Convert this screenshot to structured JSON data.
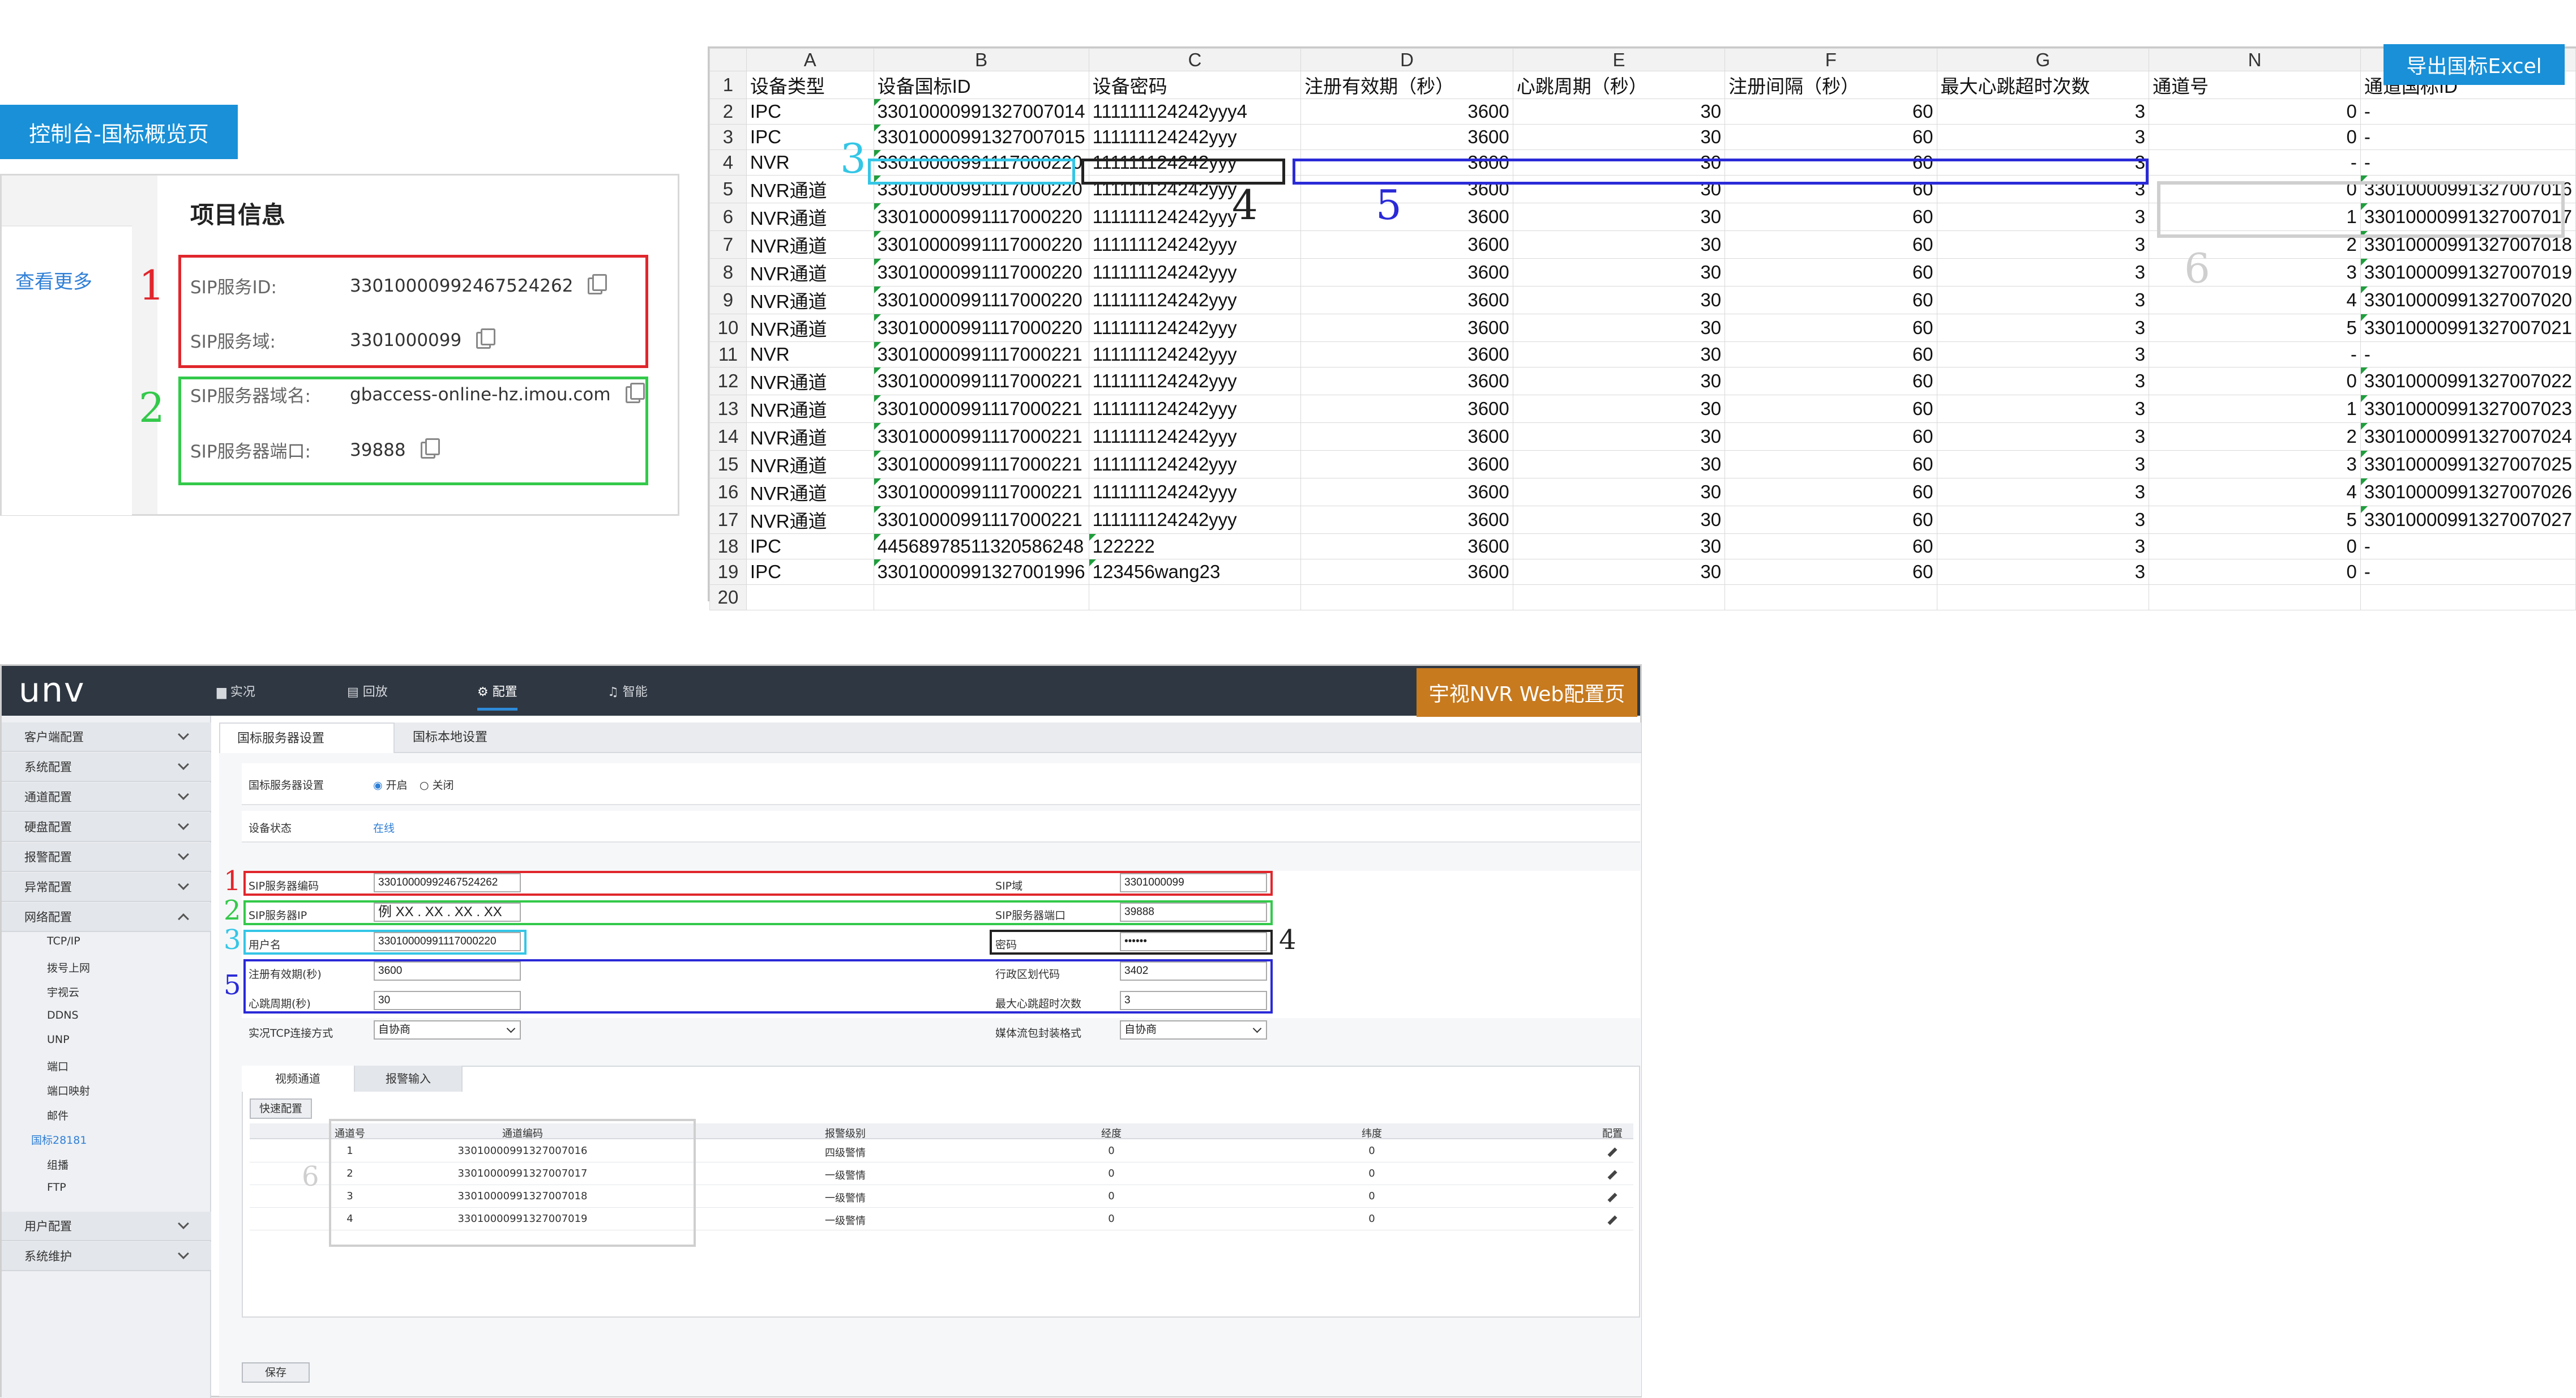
{
  "overview": {
    "tag": "控制台-国标概览页",
    "more_link": "查看更多",
    "title": "项目信息",
    "items": [
      {
        "label": "SIP服务ID:",
        "value": "33010000992467524262"
      },
      {
        "label": "SIP服务域:",
        "value": "3301000099"
      },
      {
        "label": "SIP服务器域名:",
        "value": "gbaccess-online-hz.imou.com"
      },
      {
        "label": "SIP服务器端口:",
        "value": "39888"
      }
    ]
  },
  "markers": {
    "n1": "1",
    "n2": "2",
    "n3": "3",
    "n4": "4",
    "n5": "5",
    "n6": "6"
  },
  "colors": {
    "red": "#e0262c",
    "green": "#33c94a",
    "cyan": "#34c6e6",
    "black": "#222222",
    "blue": "#2a2ad8",
    "gray": "#cfcfcf",
    "tag_blue": "#1990d7",
    "tag_brown": "#c77a1e"
  },
  "excel": {
    "export_button": "导出国标Excel",
    "column_letters": [
      "",
      "A",
      "B",
      "C",
      "D",
      "E",
      "F",
      "G",
      "N",
      ""
    ],
    "header_row": [
      "1",
      "设备类型",
      "设备国标ID",
      "设备密码",
      "注册有效期（秒）",
      "心跳周期（秒）",
      "注册间隔（秒）",
      "最大心跳超时次数",
      "通道号",
      "通道国标ID"
    ],
    "rows": [
      [
        "2",
        "IPC",
        "33010000991327007014",
        "111111124242yyy4",
        "3600",
        "30",
        "60",
        "3",
        "0",
        "-"
      ],
      [
        "3",
        "IPC",
        "33010000991327007015",
        "111111124242yyy",
        "3600",
        "30",
        "60",
        "3",
        "0",
        "-"
      ],
      [
        "4",
        "NVR",
        "33010000991117000220",
        "111111124242yyy",
        "3600",
        "30",
        "60",
        "3",
        "-",
        "-"
      ],
      [
        "5",
        "NVR通道",
        "33010000991117000220",
        "111111124242yyy",
        "3600",
        "30",
        "60",
        "3",
        "0",
        "33010000991327007016"
      ],
      [
        "6",
        "NVR通道",
        "33010000991117000220",
        "111111124242yyy",
        "3600",
        "30",
        "60",
        "3",
        "1",
        "33010000991327007017"
      ],
      [
        "7",
        "NVR通道",
        "33010000991117000220",
        "111111124242yyy",
        "3600",
        "30",
        "60",
        "3",
        "2",
        "33010000991327007018"
      ],
      [
        "8",
        "NVR通道",
        "33010000991117000220",
        "111111124242yyy",
        "3600",
        "30",
        "60",
        "3",
        "3",
        "33010000991327007019"
      ],
      [
        "9",
        "NVR通道",
        "33010000991117000220",
        "111111124242yyy",
        "3600",
        "30",
        "60",
        "3",
        "4",
        "33010000991327007020"
      ],
      [
        "10",
        "NVR通道",
        "33010000991117000220",
        "111111124242yyy",
        "3600",
        "30",
        "60",
        "3",
        "5",
        "33010000991327007021"
      ],
      [
        "11",
        "NVR",
        "33010000991117000221",
        "111111124242yyy",
        "3600",
        "30",
        "60",
        "3",
        "-",
        "-"
      ],
      [
        "12",
        "NVR通道",
        "33010000991117000221",
        "111111124242yyy",
        "3600",
        "30",
        "60",
        "3",
        "0",
        "33010000991327007022"
      ],
      [
        "13",
        "NVR通道",
        "33010000991117000221",
        "111111124242yyy",
        "3600",
        "30",
        "60",
        "3",
        "1",
        "33010000991327007023"
      ],
      [
        "14",
        "NVR通道",
        "33010000991117000221",
        "111111124242yyy",
        "3600",
        "30",
        "60",
        "3",
        "2",
        "33010000991327007024"
      ],
      [
        "15",
        "NVR通道",
        "33010000991117000221",
        "111111124242yyy",
        "3600",
        "30",
        "60",
        "3",
        "3",
        "33010000991327007025"
      ],
      [
        "16",
        "NVR通道",
        "33010000991117000221",
        "111111124242yyy",
        "3600",
        "30",
        "60",
        "3",
        "4",
        "33010000991327007026"
      ],
      [
        "17",
        "NVR通道",
        "33010000991117000221",
        "111111124242yyy",
        "3600",
        "30",
        "60",
        "3",
        "5",
        "33010000991327007027"
      ],
      [
        "18",
        "IPC",
        "44568978511320586248",
        "122222",
        "3600",
        "30",
        "60",
        "3",
        "0",
        "-"
      ],
      [
        "19",
        "IPC",
        "33010000991327001996",
        "123456wang23",
        "3600",
        "30",
        "60",
        "3",
        "0",
        "-"
      ],
      [
        "20",
        "",
        "",
        "",
        "",
        "",
        "",
        "",
        "",
        ""
      ]
    ]
  },
  "nvr": {
    "logo": "unv",
    "tag": "宇视NVR Web配置页",
    "nav": [
      "实况",
      "回放",
      "配置",
      "智能"
    ],
    "menu": [
      "客户端配置",
      "系统配置",
      "通道配置",
      "硬盘配置",
      "报警配置",
      "异常配置",
      "网络配置"
    ],
    "submenu": [
      "TCP/IP",
      "拨号上网",
      "宇视云",
      "DDNS",
      "UNP",
      "端口",
      "端口映射",
      "邮件",
      "国标28181",
      "组播",
      "FTP"
    ],
    "menu_bottom": [
      "用户配置",
      "系统维护"
    ],
    "tabs": [
      "国标服务器设置",
      "国标本地设置"
    ],
    "server_setting_label": "国标服务器设置",
    "radio_on": "开启",
    "radio_off": "关闭",
    "status_label": "设备状态",
    "status_value": "在线",
    "fields": {
      "sip_code_label": "SIP服务器编码",
      "sip_code": "33010000992467524262",
      "sip_domain_label": "SIP域",
      "sip_domain": "3301000099",
      "sip_ip_label": "SIP服务器IP",
      "sip_ip": "例 XX . XX . XX . XX",
      "sip_port_label": "SIP服务器端口",
      "sip_port": "39888",
      "user_label": "用户名",
      "user": "33010000991117000220",
      "pwd_label": "密码",
      "pwd": "••••••",
      "reg_label": "注册有效期(秒)",
      "reg": "3600",
      "region_label": "行政区划代码",
      "region": "3402",
      "hb_label": "心跳周期(秒)",
      "hb": "30",
      "maxhb_label": "最大心跳超时次数",
      "maxhb": "3",
      "tcp_label": "实况TCP连接方式",
      "tcp": "自协商",
      "stream_label": "媒体流包封装格式",
      "stream": "自协商"
    },
    "inner_tabs": [
      "视频通道",
      "报警输入"
    ],
    "quick_button": "快速配置",
    "table_headers": [
      "通道号",
      "通道编码",
      "报警级别",
      "经度",
      "纬度",
      "配置"
    ],
    "table_rows": [
      [
        "1",
        "33010000991327007016",
        "四级警情",
        "0",
        "0"
      ],
      [
        "2",
        "33010000991327007017",
        "一级警情",
        "0",
        "0"
      ],
      [
        "3",
        "33010000991327007018",
        "一级警情",
        "0",
        "0"
      ],
      [
        "4",
        "33010000991327007019",
        "一级警情",
        "0",
        "0"
      ]
    ],
    "save_button": "保存"
  }
}
